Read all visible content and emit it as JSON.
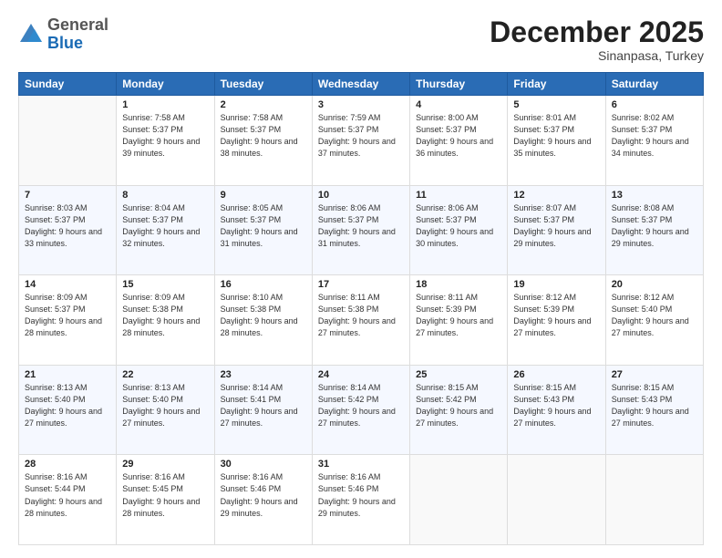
{
  "header": {
    "logo_general": "General",
    "logo_blue": "Blue",
    "month_title": "December 2025",
    "subtitle": "Sinanpasa, Turkey"
  },
  "weekdays": [
    "Sunday",
    "Monday",
    "Tuesday",
    "Wednesday",
    "Thursday",
    "Friday",
    "Saturday"
  ],
  "weeks": [
    [
      {
        "day": "",
        "sunrise": "",
        "sunset": "",
        "daylight": ""
      },
      {
        "day": "1",
        "sunrise": "Sunrise: 7:58 AM",
        "sunset": "Sunset: 5:37 PM",
        "daylight": "Daylight: 9 hours and 39 minutes."
      },
      {
        "day": "2",
        "sunrise": "Sunrise: 7:58 AM",
        "sunset": "Sunset: 5:37 PM",
        "daylight": "Daylight: 9 hours and 38 minutes."
      },
      {
        "day": "3",
        "sunrise": "Sunrise: 7:59 AM",
        "sunset": "Sunset: 5:37 PM",
        "daylight": "Daylight: 9 hours and 37 minutes."
      },
      {
        "day": "4",
        "sunrise": "Sunrise: 8:00 AM",
        "sunset": "Sunset: 5:37 PM",
        "daylight": "Daylight: 9 hours and 36 minutes."
      },
      {
        "day": "5",
        "sunrise": "Sunrise: 8:01 AM",
        "sunset": "Sunset: 5:37 PM",
        "daylight": "Daylight: 9 hours and 35 minutes."
      },
      {
        "day": "6",
        "sunrise": "Sunrise: 8:02 AM",
        "sunset": "Sunset: 5:37 PM",
        "daylight": "Daylight: 9 hours and 34 minutes."
      }
    ],
    [
      {
        "day": "7",
        "sunrise": "Sunrise: 8:03 AM",
        "sunset": "Sunset: 5:37 PM",
        "daylight": "Daylight: 9 hours and 33 minutes."
      },
      {
        "day": "8",
        "sunrise": "Sunrise: 8:04 AM",
        "sunset": "Sunset: 5:37 PM",
        "daylight": "Daylight: 9 hours and 32 minutes."
      },
      {
        "day": "9",
        "sunrise": "Sunrise: 8:05 AM",
        "sunset": "Sunset: 5:37 PM",
        "daylight": "Daylight: 9 hours and 31 minutes."
      },
      {
        "day": "10",
        "sunrise": "Sunrise: 8:06 AM",
        "sunset": "Sunset: 5:37 PM",
        "daylight": "Daylight: 9 hours and 31 minutes."
      },
      {
        "day": "11",
        "sunrise": "Sunrise: 8:06 AM",
        "sunset": "Sunset: 5:37 PM",
        "daylight": "Daylight: 9 hours and 30 minutes."
      },
      {
        "day": "12",
        "sunrise": "Sunrise: 8:07 AM",
        "sunset": "Sunset: 5:37 PM",
        "daylight": "Daylight: 9 hours and 29 minutes."
      },
      {
        "day": "13",
        "sunrise": "Sunrise: 8:08 AM",
        "sunset": "Sunset: 5:37 PM",
        "daylight": "Daylight: 9 hours and 29 minutes."
      }
    ],
    [
      {
        "day": "14",
        "sunrise": "Sunrise: 8:09 AM",
        "sunset": "Sunset: 5:37 PM",
        "daylight": "Daylight: 9 hours and 28 minutes."
      },
      {
        "day": "15",
        "sunrise": "Sunrise: 8:09 AM",
        "sunset": "Sunset: 5:38 PM",
        "daylight": "Daylight: 9 hours and 28 minutes."
      },
      {
        "day": "16",
        "sunrise": "Sunrise: 8:10 AM",
        "sunset": "Sunset: 5:38 PM",
        "daylight": "Daylight: 9 hours and 28 minutes."
      },
      {
        "day": "17",
        "sunrise": "Sunrise: 8:11 AM",
        "sunset": "Sunset: 5:38 PM",
        "daylight": "Daylight: 9 hours and 27 minutes."
      },
      {
        "day": "18",
        "sunrise": "Sunrise: 8:11 AM",
        "sunset": "Sunset: 5:39 PM",
        "daylight": "Daylight: 9 hours and 27 minutes."
      },
      {
        "day": "19",
        "sunrise": "Sunrise: 8:12 AM",
        "sunset": "Sunset: 5:39 PM",
        "daylight": "Daylight: 9 hours and 27 minutes."
      },
      {
        "day": "20",
        "sunrise": "Sunrise: 8:12 AM",
        "sunset": "Sunset: 5:40 PM",
        "daylight": "Daylight: 9 hours and 27 minutes."
      }
    ],
    [
      {
        "day": "21",
        "sunrise": "Sunrise: 8:13 AM",
        "sunset": "Sunset: 5:40 PM",
        "daylight": "Daylight: 9 hours and 27 minutes."
      },
      {
        "day": "22",
        "sunrise": "Sunrise: 8:13 AM",
        "sunset": "Sunset: 5:40 PM",
        "daylight": "Daylight: 9 hours and 27 minutes."
      },
      {
        "day": "23",
        "sunrise": "Sunrise: 8:14 AM",
        "sunset": "Sunset: 5:41 PM",
        "daylight": "Daylight: 9 hours and 27 minutes."
      },
      {
        "day": "24",
        "sunrise": "Sunrise: 8:14 AM",
        "sunset": "Sunset: 5:42 PM",
        "daylight": "Daylight: 9 hours and 27 minutes."
      },
      {
        "day": "25",
        "sunrise": "Sunrise: 8:15 AM",
        "sunset": "Sunset: 5:42 PM",
        "daylight": "Daylight: 9 hours and 27 minutes."
      },
      {
        "day": "26",
        "sunrise": "Sunrise: 8:15 AM",
        "sunset": "Sunset: 5:43 PM",
        "daylight": "Daylight: 9 hours and 27 minutes."
      },
      {
        "day": "27",
        "sunrise": "Sunrise: 8:15 AM",
        "sunset": "Sunset: 5:43 PM",
        "daylight": "Daylight: 9 hours and 27 minutes."
      }
    ],
    [
      {
        "day": "28",
        "sunrise": "Sunrise: 8:16 AM",
        "sunset": "Sunset: 5:44 PM",
        "daylight": "Daylight: 9 hours and 28 minutes."
      },
      {
        "day": "29",
        "sunrise": "Sunrise: 8:16 AM",
        "sunset": "Sunset: 5:45 PM",
        "daylight": "Daylight: 9 hours and 28 minutes."
      },
      {
        "day": "30",
        "sunrise": "Sunrise: 8:16 AM",
        "sunset": "Sunset: 5:46 PM",
        "daylight": "Daylight: 9 hours and 29 minutes."
      },
      {
        "day": "31",
        "sunrise": "Sunrise: 8:16 AM",
        "sunset": "Sunset: 5:46 PM",
        "daylight": "Daylight: 9 hours and 29 minutes."
      },
      {
        "day": "",
        "sunrise": "",
        "sunset": "",
        "daylight": ""
      },
      {
        "day": "",
        "sunrise": "",
        "sunset": "",
        "daylight": ""
      },
      {
        "day": "",
        "sunrise": "",
        "sunset": "",
        "daylight": ""
      }
    ]
  ]
}
